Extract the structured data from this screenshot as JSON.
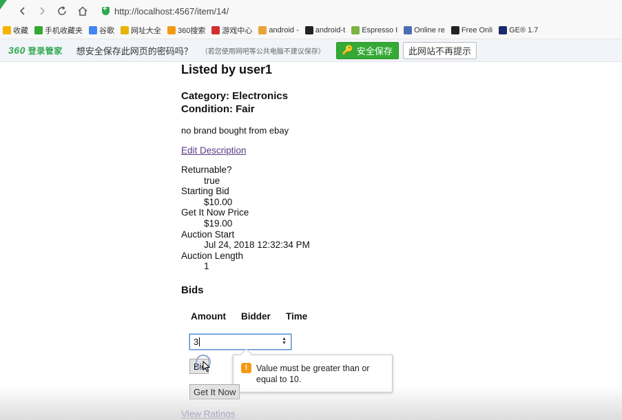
{
  "browser": {
    "url": "http://localhost:4567/item/14/",
    "bookmarks": [
      {
        "label": "收藏",
        "icon": "star-icon",
        "color": "#f5b400"
      },
      {
        "label": "手机收藏夹",
        "icon": "phone-icon",
        "color": "#35a935"
      },
      {
        "label": "谷歌",
        "icon": "google-icon",
        "color": "#4285f4"
      },
      {
        "label": "网址大全",
        "icon": "globe-icon",
        "color": "#e8b400"
      },
      {
        "label": "360搜索",
        "icon": "360-search-icon",
        "color": "#f29b12"
      },
      {
        "label": "游戏中心",
        "icon": "game-icon",
        "color": "#d32f2f"
      },
      {
        "label": "android -",
        "icon": "android-doc-icon",
        "color": "#e8a33b"
      },
      {
        "label": "android-t",
        "icon": "github-icon",
        "color": "#222222"
      },
      {
        "label": "Espresso I",
        "icon": "android-icon",
        "color": "#7cb342"
      },
      {
        "label": "Online re",
        "icon": "r-icon",
        "color": "#4a6fb5"
      },
      {
        "label": "Free Onli",
        "icon": "ff-icon",
        "color": "#222222"
      },
      {
        "label": "GE® 1.7",
        "icon": "ge-icon",
        "color": "#1a2a6c"
      }
    ]
  },
  "password_bar": {
    "brand_num": "360",
    "brand_text": "登录管家",
    "question": "想安全保存此网页的密码吗？",
    "note": "（若您使用网吧等公共电脑不建议保存）",
    "save_label": "安全保存",
    "never_label": "此网站不再提示"
  },
  "item": {
    "listed_by": "Listed by user1",
    "category": "Category: Electronics",
    "condition": "Condition: Fair",
    "description": "no brand bought from ebay",
    "edit_label": "Edit Description",
    "details": [
      {
        "term": "Returnable?",
        "value": "true"
      },
      {
        "term": "Starting Bid",
        "value": "$10.00"
      },
      {
        "term": "Get It Now Price",
        "value": "$19.00"
      },
      {
        "term": "Auction Start",
        "value": "Jul 24, 2018 12:32:34 PM"
      },
      {
        "term": "Auction Length",
        "value": "1"
      }
    ]
  },
  "bids": {
    "heading": "Bids",
    "columns": [
      "Amount",
      "Bidder",
      "Time"
    ],
    "amount_value": "3",
    "bid_label": "Bid",
    "get_now_label": "Get It Now",
    "validation_message": "Value must be greater than or equal to 10.",
    "ratings_label": "View Ratings"
  }
}
